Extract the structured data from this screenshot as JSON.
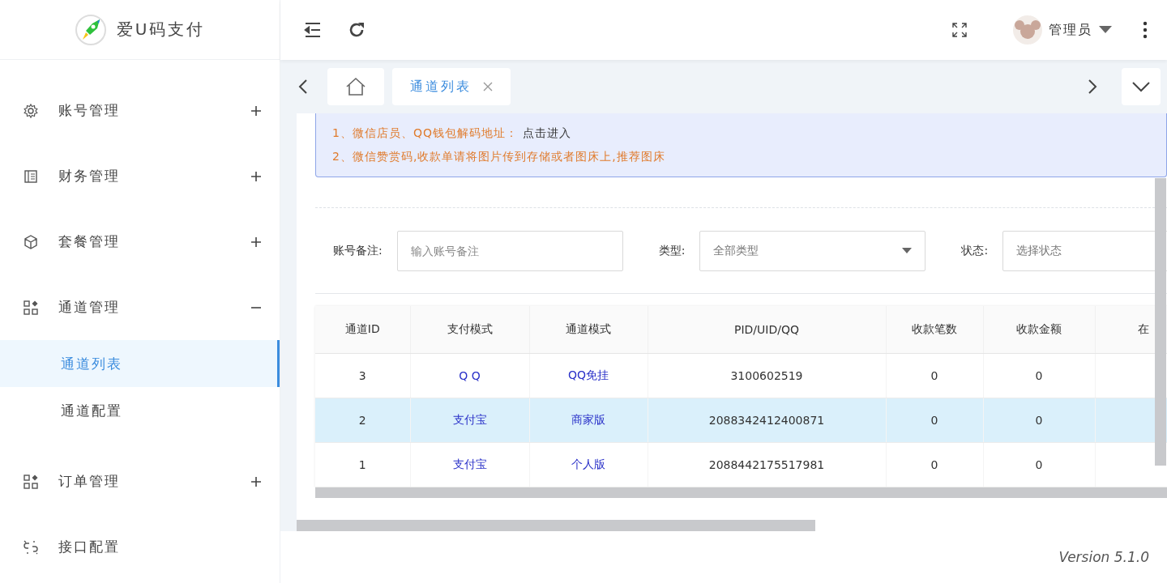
{
  "brand": {
    "name": "爱U码支付"
  },
  "header": {
    "user": "管理员"
  },
  "sidebar": {
    "items": [
      {
        "label": "账号管理",
        "kind": "group",
        "expanded": false
      },
      {
        "label": "财务管理",
        "kind": "group",
        "expanded": false
      },
      {
        "label": "套餐管理",
        "kind": "group",
        "expanded": false
      },
      {
        "label": "通道管理",
        "kind": "group",
        "expanded": true,
        "children": [
          {
            "label": "通道列表",
            "selected": true
          },
          {
            "label": "通道配置",
            "selected": false
          }
        ]
      },
      {
        "label": "订单管理",
        "kind": "group",
        "expanded": false
      },
      {
        "label": "接口配置",
        "kind": "link"
      }
    ]
  },
  "tabs": [
    {
      "kind": "home",
      "selected": false
    },
    {
      "kind": "page",
      "label": "通道列表",
      "selected": true
    }
  ],
  "notice": [
    {
      "text": "1、微信店员、QQ钱包解码地址：",
      "link": "点击进入"
    },
    {
      "text": "2、微信赞赏码,收款单请将图片传到存储或者图床上,推荐图床"
    }
  ],
  "filters": [
    {
      "label": "账号备注:",
      "kind": "input",
      "placeholder": "输入账号备注"
    },
    {
      "label": "类型:",
      "kind": "select",
      "value": "全部类型"
    },
    {
      "label": "状态:",
      "kind": "select",
      "value": "选择状态"
    }
  ],
  "table": {
    "columns": [
      "通道ID",
      "支付模式",
      "通道模式",
      "PID/UID/QQ",
      "收款笔数",
      "收款金额",
      "在"
    ],
    "rows": [
      {
        "cells": [
          "3",
          "Q Q",
          "QQ免挂",
          "3100602519",
          "0",
          "0",
          ""
        ],
        "selected": false
      },
      {
        "cells": [
          "2",
          "支付宝",
          "商家版",
          "2088342412400871",
          "0",
          "0",
          ""
        ],
        "selected": true
      },
      {
        "cells": [
          "1",
          "支付宝",
          "个人版",
          "2088442175517981",
          "0",
          "0",
          ""
        ],
        "selected": false
      }
    ]
  },
  "footer": {
    "version": "Version 5.1.0"
  }
}
